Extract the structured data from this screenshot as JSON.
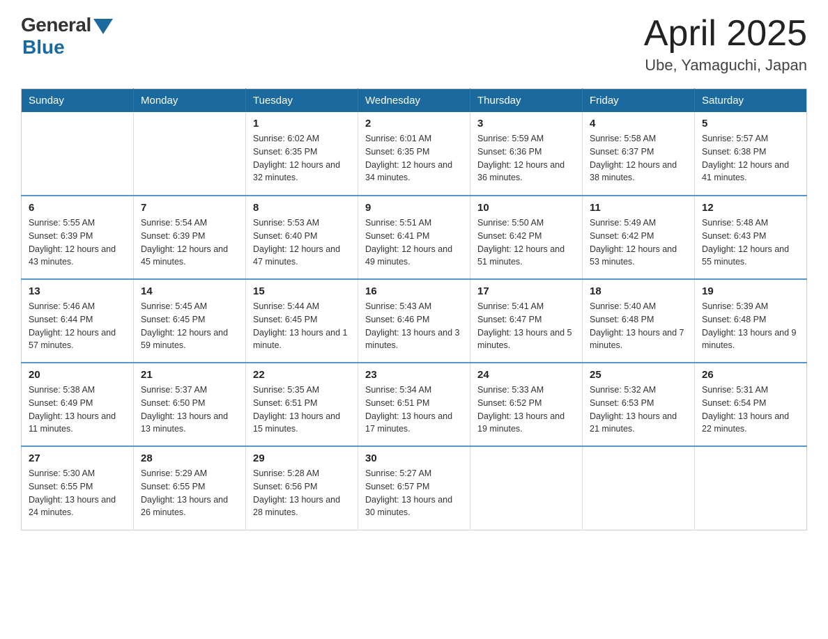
{
  "header": {
    "logo_general": "General",
    "logo_blue": "Blue",
    "month_title": "April 2025",
    "location": "Ube, Yamaguchi, Japan"
  },
  "weekdays": [
    "Sunday",
    "Monday",
    "Tuesday",
    "Wednesday",
    "Thursday",
    "Friday",
    "Saturday"
  ],
  "weeks": [
    [
      {
        "day": "",
        "sunrise": "",
        "sunset": "",
        "daylight": ""
      },
      {
        "day": "",
        "sunrise": "",
        "sunset": "",
        "daylight": ""
      },
      {
        "day": "1",
        "sunrise": "Sunrise: 6:02 AM",
        "sunset": "Sunset: 6:35 PM",
        "daylight": "Daylight: 12 hours and 32 minutes."
      },
      {
        "day": "2",
        "sunrise": "Sunrise: 6:01 AM",
        "sunset": "Sunset: 6:35 PM",
        "daylight": "Daylight: 12 hours and 34 minutes."
      },
      {
        "day": "3",
        "sunrise": "Sunrise: 5:59 AM",
        "sunset": "Sunset: 6:36 PM",
        "daylight": "Daylight: 12 hours and 36 minutes."
      },
      {
        "day": "4",
        "sunrise": "Sunrise: 5:58 AM",
        "sunset": "Sunset: 6:37 PM",
        "daylight": "Daylight: 12 hours and 38 minutes."
      },
      {
        "day": "5",
        "sunrise": "Sunrise: 5:57 AM",
        "sunset": "Sunset: 6:38 PM",
        "daylight": "Daylight: 12 hours and 41 minutes."
      }
    ],
    [
      {
        "day": "6",
        "sunrise": "Sunrise: 5:55 AM",
        "sunset": "Sunset: 6:39 PM",
        "daylight": "Daylight: 12 hours and 43 minutes."
      },
      {
        "day": "7",
        "sunrise": "Sunrise: 5:54 AM",
        "sunset": "Sunset: 6:39 PM",
        "daylight": "Daylight: 12 hours and 45 minutes."
      },
      {
        "day": "8",
        "sunrise": "Sunrise: 5:53 AM",
        "sunset": "Sunset: 6:40 PM",
        "daylight": "Daylight: 12 hours and 47 minutes."
      },
      {
        "day": "9",
        "sunrise": "Sunrise: 5:51 AM",
        "sunset": "Sunset: 6:41 PM",
        "daylight": "Daylight: 12 hours and 49 minutes."
      },
      {
        "day": "10",
        "sunrise": "Sunrise: 5:50 AM",
        "sunset": "Sunset: 6:42 PM",
        "daylight": "Daylight: 12 hours and 51 minutes."
      },
      {
        "day": "11",
        "sunrise": "Sunrise: 5:49 AM",
        "sunset": "Sunset: 6:42 PM",
        "daylight": "Daylight: 12 hours and 53 minutes."
      },
      {
        "day": "12",
        "sunrise": "Sunrise: 5:48 AM",
        "sunset": "Sunset: 6:43 PM",
        "daylight": "Daylight: 12 hours and 55 minutes."
      }
    ],
    [
      {
        "day": "13",
        "sunrise": "Sunrise: 5:46 AM",
        "sunset": "Sunset: 6:44 PM",
        "daylight": "Daylight: 12 hours and 57 minutes."
      },
      {
        "day": "14",
        "sunrise": "Sunrise: 5:45 AM",
        "sunset": "Sunset: 6:45 PM",
        "daylight": "Daylight: 12 hours and 59 minutes."
      },
      {
        "day": "15",
        "sunrise": "Sunrise: 5:44 AM",
        "sunset": "Sunset: 6:45 PM",
        "daylight": "Daylight: 13 hours and 1 minute."
      },
      {
        "day": "16",
        "sunrise": "Sunrise: 5:43 AM",
        "sunset": "Sunset: 6:46 PM",
        "daylight": "Daylight: 13 hours and 3 minutes."
      },
      {
        "day": "17",
        "sunrise": "Sunrise: 5:41 AM",
        "sunset": "Sunset: 6:47 PM",
        "daylight": "Daylight: 13 hours and 5 minutes."
      },
      {
        "day": "18",
        "sunrise": "Sunrise: 5:40 AM",
        "sunset": "Sunset: 6:48 PM",
        "daylight": "Daylight: 13 hours and 7 minutes."
      },
      {
        "day": "19",
        "sunrise": "Sunrise: 5:39 AM",
        "sunset": "Sunset: 6:48 PM",
        "daylight": "Daylight: 13 hours and 9 minutes."
      }
    ],
    [
      {
        "day": "20",
        "sunrise": "Sunrise: 5:38 AM",
        "sunset": "Sunset: 6:49 PM",
        "daylight": "Daylight: 13 hours and 11 minutes."
      },
      {
        "day": "21",
        "sunrise": "Sunrise: 5:37 AM",
        "sunset": "Sunset: 6:50 PM",
        "daylight": "Daylight: 13 hours and 13 minutes."
      },
      {
        "day": "22",
        "sunrise": "Sunrise: 5:35 AM",
        "sunset": "Sunset: 6:51 PM",
        "daylight": "Daylight: 13 hours and 15 minutes."
      },
      {
        "day": "23",
        "sunrise": "Sunrise: 5:34 AM",
        "sunset": "Sunset: 6:51 PM",
        "daylight": "Daylight: 13 hours and 17 minutes."
      },
      {
        "day": "24",
        "sunrise": "Sunrise: 5:33 AM",
        "sunset": "Sunset: 6:52 PM",
        "daylight": "Daylight: 13 hours and 19 minutes."
      },
      {
        "day": "25",
        "sunrise": "Sunrise: 5:32 AM",
        "sunset": "Sunset: 6:53 PM",
        "daylight": "Daylight: 13 hours and 21 minutes."
      },
      {
        "day": "26",
        "sunrise": "Sunrise: 5:31 AM",
        "sunset": "Sunset: 6:54 PM",
        "daylight": "Daylight: 13 hours and 22 minutes."
      }
    ],
    [
      {
        "day": "27",
        "sunrise": "Sunrise: 5:30 AM",
        "sunset": "Sunset: 6:55 PM",
        "daylight": "Daylight: 13 hours and 24 minutes."
      },
      {
        "day": "28",
        "sunrise": "Sunrise: 5:29 AM",
        "sunset": "Sunset: 6:55 PM",
        "daylight": "Daylight: 13 hours and 26 minutes."
      },
      {
        "day": "29",
        "sunrise": "Sunrise: 5:28 AM",
        "sunset": "Sunset: 6:56 PM",
        "daylight": "Daylight: 13 hours and 28 minutes."
      },
      {
        "day": "30",
        "sunrise": "Sunrise: 5:27 AM",
        "sunset": "Sunset: 6:57 PM",
        "daylight": "Daylight: 13 hours and 30 minutes."
      },
      {
        "day": "",
        "sunrise": "",
        "sunset": "",
        "daylight": ""
      },
      {
        "day": "",
        "sunrise": "",
        "sunset": "",
        "daylight": ""
      },
      {
        "day": "",
        "sunrise": "",
        "sunset": "",
        "daylight": ""
      }
    ]
  ]
}
